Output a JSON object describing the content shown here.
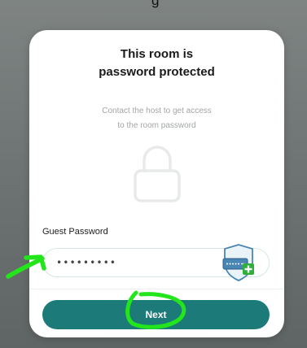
{
  "background": {
    "top_fragment_text": "g"
  },
  "modal": {
    "title_line1": "This room is",
    "title_line2": "password protected",
    "subtitle_line1": "Contact the host to get access",
    "subtitle_line2": "to the room password",
    "lock_icon": "lock-icon"
  },
  "password": {
    "label": "Guest Password",
    "value": "•••••••••",
    "manager_icon": "password-manager-shield-icon"
  },
  "actions": {
    "next_label": "Next"
  },
  "annotations": {
    "arrow_icon": "green-arrow-annotation",
    "circle_icon": "green-circle-annotation"
  },
  "colors": {
    "accent": "#1c7a79",
    "annotation": "#22e51b",
    "background": "#6f7574",
    "muted_text": "#a3a6a6"
  }
}
